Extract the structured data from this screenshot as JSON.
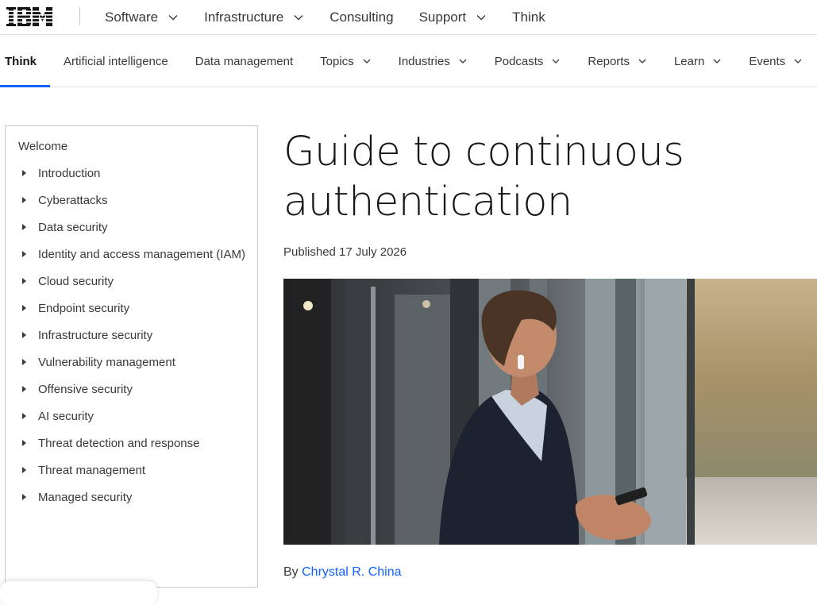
{
  "brand": {
    "logo_text": "IBM"
  },
  "masthead": {
    "items": [
      {
        "label": "Software",
        "has_menu": true
      },
      {
        "label": "Infrastructure",
        "has_menu": true
      },
      {
        "label": "Consulting",
        "has_menu": false
      },
      {
        "label": "Support",
        "has_menu": true
      },
      {
        "label": "Think",
        "has_menu": false
      }
    ]
  },
  "subnav": {
    "items": [
      {
        "label": "Think",
        "active": true
      },
      {
        "label": "Artificial intelligence"
      },
      {
        "label": "Data management"
      },
      {
        "label": "Topics",
        "has_menu": true
      },
      {
        "label": "Industries",
        "has_menu": true
      },
      {
        "label": "Podcasts",
        "has_menu": true
      },
      {
        "label": "Reports",
        "has_menu": true
      },
      {
        "label": "Learn",
        "has_menu": true
      },
      {
        "label": "Events",
        "has_menu": true
      }
    ]
  },
  "sidebar": {
    "welcome": "Welcome",
    "items": [
      {
        "label": "Introduction"
      },
      {
        "label": "Cyberattacks"
      },
      {
        "label": "Data security"
      },
      {
        "label": "Identity and access management (IAM)"
      },
      {
        "label": "Cloud security"
      },
      {
        "label": "Endpoint security"
      },
      {
        "label": "Infrastructure security"
      },
      {
        "label": "Vulnerability management"
      },
      {
        "label": "Offensive security"
      },
      {
        "label": "AI security"
      },
      {
        "label": "Threat detection and response"
      },
      {
        "label": "Threat management"
      },
      {
        "label": "Managed security"
      }
    ]
  },
  "article": {
    "title": "Guide to continuous authentication",
    "published": "Published 17 July 2026",
    "byline_prefix": "By",
    "author": "Chrystal R. China"
  },
  "colors": {
    "accent": "#0f62fe",
    "text": "#161616",
    "secondary_text": "#393939",
    "border": "#e0e0e0"
  }
}
